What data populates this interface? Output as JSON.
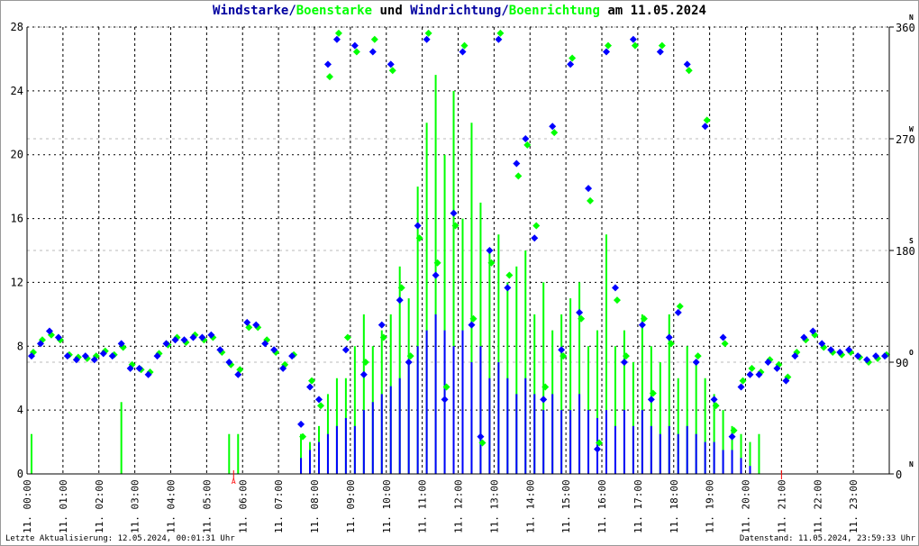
{
  "title": {
    "part1": "Windstarke",
    "sep1": "/",
    "part2": "Boenstarke",
    "mid": " und ",
    "part3": "Windrichtung",
    "sep2": "/",
    "part4": "Boenrichtung",
    "tail": " am 11.05.2024"
  },
  "footer": {
    "left": "Letzte Aktualisierung: 12.05.2024, 00:01:31 Uhr",
    "right": "Datenstand: 11.05.2024, 23:59:33 Uhr"
  },
  "colors": {
    "wind": "#0000ff",
    "gust": "#00ff00",
    "marker": "#ff0000",
    "grid": "#000000",
    "grid_dir": "#bbbbbb"
  },
  "chart_data": {
    "type": "line",
    "title": "Windstarke/Boenstarke und Windrichtung/Boenrichtung am 11.05.2024",
    "xlabel": "",
    "ylabel": "",
    "ylabel_right": "",
    "x_ticks": [
      "11. 00:00",
      "11. 01:00",
      "11. 02:00",
      "11. 03:00",
      "11. 04:00",
      "11. 05:00",
      "11. 06:00",
      "11. 07:00",
      "11. 08:00",
      "11. 09:00",
      "11. 10:00",
      "11. 11:00",
      "11. 12:00",
      "11. 13:00",
      "11. 14:00",
      "11. 15:00",
      "11. 16:00",
      "11. 17:00",
      "11. 18:00",
      "11. 19:00",
      "11. 20:00",
      "11. 21:00",
      "11. 22:00",
      "11. 23:00"
    ],
    "ylim": [
      0,
      28
    ],
    "y_ticks": [
      "0",
      "4",
      "8",
      "12",
      "16",
      "20",
      "24",
      "28"
    ],
    "ylim_right": [
      0,
      360
    ],
    "y_ticks_right": [
      {
        "v": "0",
        "c": "N"
      },
      {
        "v": "90",
        "c": "O"
      },
      {
        "v": "180",
        "c": "S"
      },
      {
        "v": "270",
        "c": "W"
      },
      {
        "v": "360",
        "c": "N"
      }
    ],
    "markers": [
      {
        "hour": 5.75,
        "label": "A"
      },
      {
        "hour": 21.0,
        "label": ""
      }
    ],
    "grid": true,
    "x_step_hours": 0.25,
    "series": [
      {
        "name": "Windstarke",
        "axis": "left",
        "style": "bars",
        "values": [
          0,
          0,
          0,
          0,
          0,
          0,
          0,
          0,
          0,
          0,
          0,
          0,
          0,
          0,
          0,
          0,
          0,
          0,
          0,
          0,
          0,
          0,
          0,
          0,
          0,
          0,
          0,
          0,
          0,
          0,
          1,
          1.5,
          2,
          2.5,
          3,
          3.5,
          3,
          4,
          4.5,
          5,
          5.5,
          6,
          7,
          8,
          9,
          10,
          9,
          8,
          9,
          7,
          8,
          6,
          7,
          6,
          5,
          6,
          5,
          4,
          5,
          4,
          4,
          5,
          4,
          3.5,
          4,
          3,
          4,
          3,
          4,
          3,
          2.5,
          3,
          2.5,
          3,
          2.5,
          2,
          2,
          1.5,
          1.5,
          1,
          0.5,
          0,
          0,
          0,
          0,
          0,
          0,
          0,
          0,
          0,
          0,
          0,
          0,
          0,
          0,
          0
        ]
      },
      {
        "name": "Boenstarke",
        "axis": "left",
        "style": "bars",
        "values": [
          2.5,
          0,
          0,
          0,
          0,
          0,
          0,
          0,
          0,
          0,
          4.5,
          0,
          0,
          0,
          0,
          0,
          0,
          0,
          0,
          0,
          0,
          0,
          2.5,
          2.5,
          0,
          0,
          0,
          0,
          0,
          0,
          2.5,
          2,
          3,
          5,
          6,
          6,
          8,
          10,
          8,
          9,
          10,
          13,
          11,
          18,
          22,
          25,
          20,
          24,
          16,
          22,
          17,
          14,
          15,
          12,
          13,
          14,
          10,
          12,
          9,
          10,
          11,
          12,
          8,
          9,
          15,
          8,
          9,
          7,
          10,
          8,
          7,
          10,
          6,
          8,
          7,
          6,
          5,
          4,
          3,
          2.5,
          2,
          2.5,
          0,
          0,
          0,
          0,
          0,
          0,
          0,
          0,
          0,
          0,
          0,
          0,
          0,
          0
        ]
      },
      {
        "name": "Windrichtung",
        "axis": "right",
        "style": "points",
        "values": [
          95,
          105,
          115,
          110,
          95,
          92,
          95,
          92,
          97,
          95,
          105,
          85,
          85,
          80,
          95,
          105,
          108,
          108,
          110,
          110,
          112,
          100,
          90,
          80,
          122,
          120,
          105,
          100,
          85,
          95,
          40,
          70,
          60,
          330,
          350,
          100,
          345,
          80,
          340,
          120,
          330,
          140,
          90,
          200,
          350,
          160,
          60,
          210,
          340,
          120,
          30,
          180,
          350,
          150,
          250,
          270,
          190,
          60,
          280,
          100,
          330,
          130,
          230,
          20,
          340,
          150,
          90,
          350,
          120,
          60,
          340,
          110,
          130,
          330,
          90,
          280,
          60,
          110,
          30,
          70,
          80,
          80,
          90,
          85,
          75,
          95,
          110,
          115,
          105,
          100,
          98,
          100,
          95,
          92,
          95,
          95
        ]
      },
      {
        "name": "Boenrichtung",
        "axis": "right",
        "style": "points",
        "values": [
          98,
          108,
          112,
          108,
          96,
          94,
          93,
          95,
          99,
          96,
          102,
          88,
          84,
          82,
          97,
          104,
          110,
          106,
          112,
          108,
          110,
          98,
          88,
          84,
          118,
          118,
          108,
          98,
          88,
          96,
          30,
          75,
          55,
          320,
          355,
          110,
          340,
          90,
          350,
          110,
          325,
          150,
          95,
          190,
          355,
          170,
          70,
          200,
          345,
          125,
          25,
          170,
          355,
          160,
          240,
          265,
          200,
          70,
          275,
          95,
          335,
          125,
          220,
          25,
          345,
          140,
          95,
          345,
          125,
          65,
          345,
          105,
          135,
          325,
          95,
          285,
          55,
          105,
          35,
          75,
          85,
          82,
          92,
          88,
          78,
          98,
          108,
          112,
          102,
          98,
          96,
          98,
          94,
          90,
          93,
          96
        ]
      }
    ]
  }
}
